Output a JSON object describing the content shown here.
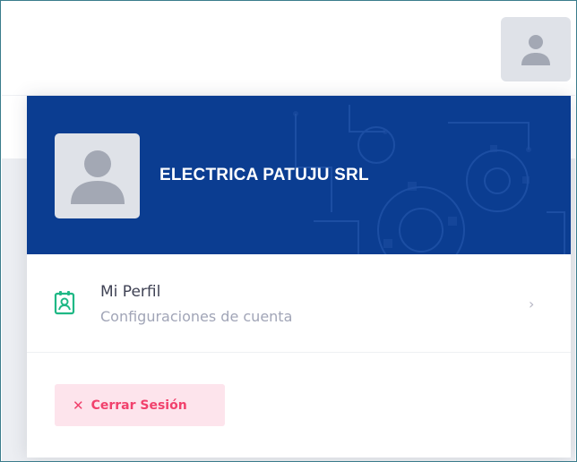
{
  "colors": {
    "header_bg": "#0b3d91",
    "avatar_bg": "#dfe2e8",
    "profile_icon": "#1fb885",
    "danger": "#f1416c",
    "danger_light": "#fde4ec"
  },
  "topbar": {
    "avatar_icon": "user-icon"
  },
  "user_menu": {
    "company_name": "ELECTRICA PATUJU SRL",
    "avatar_icon": "user-icon",
    "profile_item": {
      "icon": "id-badge-icon",
      "title": "Mi Perfil",
      "subtitle": "Configuraciones de cuenta",
      "chevron": "›"
    },
    "logout": {
      "icon": "x",
      "label": "Cerrar Sesión"
    }
  }
}
